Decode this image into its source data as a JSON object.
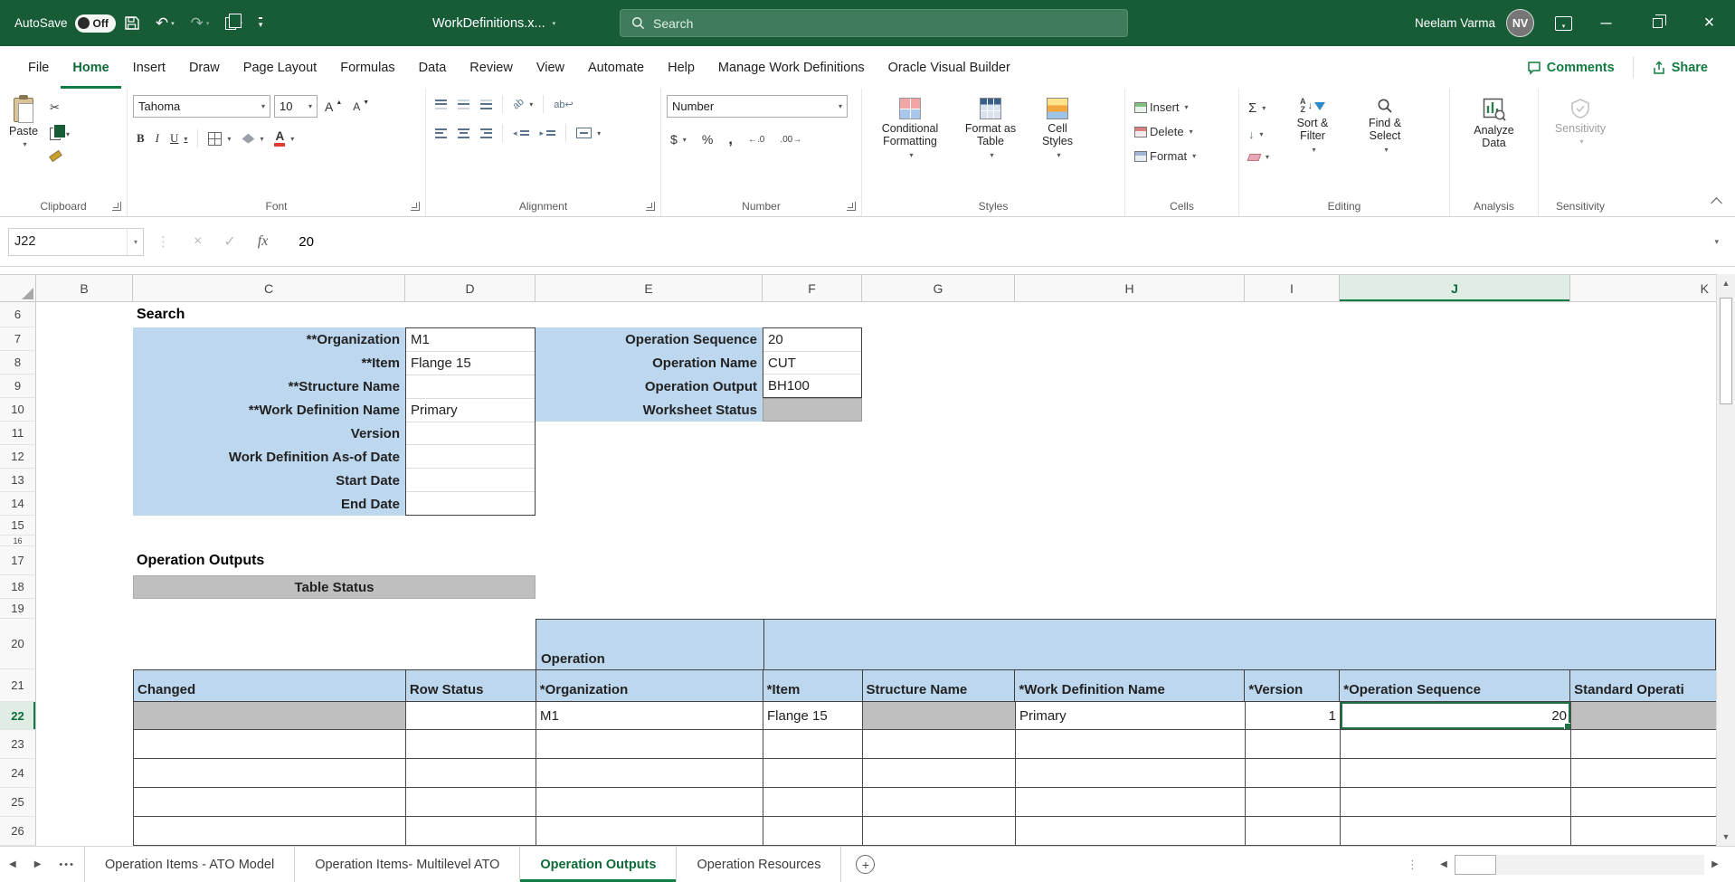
{
  "colors": {
    "titlebar_green": "#185C37",
    "accent_green": "#107C41",
    "cell_blue": "#BDD7EE",
    "cell_gray": "#BFBFBF"
  },
  "titlebar": {
    "autosave_label": "AutoSave",
    "autosave_state": "Off",
    "document_title": "WorkDefinitions.x...",
    "search_placeholder": "Search",
    "user_name": "Neelam Varma",
    "user_initials": "NV"
  },
  "menu": {
    "tabs": [
      "File",
      "Home",
      "Insert",
      "Draw",
      "Page Layout",
      "Formulas",
      "Data",
      "Review",
      "View",
      "Automate",
      "Help",
      "Manage Work Definitions",
      "Oracle Visual Builder"
    ],
    "active_tab": "Home",
    "comments": "Comments",
    "share": "Share"
  },
  "ribbon": {
    "paste": "Paste",
    "clipboard_group": "Clipboard",
    "font_name": "Tahoma",
    "font_size": "10",
    "bold_label": "B",
    "italic_label": "I",
    "underline_label": "U",
    "increase_font_label": "A",
    "decrease_font_label": "A",
    "font_color_label": "A",
    "font_group": "Font",
    "orientation_label": "ab",
    "wrap_label": "ab",
    "alignment_group": "Alignment",
    "number_format": "Number",
    "currency_label": "$",
    "percent_label": "%",
    "comma_label": ",",
    "number_group": "Number",
    "conditional_formatting": "Conditional Formatting",
    "format_as_table": "Format as Table",
    "cell_styles": "Cell Styles",
    "styles_group": "Styles",
    "insert": "Insert",
    "delete": "Delete",
    "format": "Format",
    "cells_group": "Cells",
    "autosum_label": "Σ",
    "sort_filter": "Sort & Filter",
    "find_select": "Find & Select",
    "editing_group": "Editing",
    "analyze_data": "Analyze Data",
    "analysis_group": "Analysis",
    "sensitivity": "Sensitivity",
    "sensitivity_group": "Sensitivity"
  },
  "formula_bar": {
    "name_box": "J22",
    "fx_label": "fx",
    "value": "20"
  },
  "grid": {
    "columns": [
      "B",
      "C",
      "D",
      "E",
      "F",
      "G",
      "H",
      "I",
      "J",
      "K"
    ],
    "rows": [
      "6",
      "7",
      "8",
      "9",
      "10",
      "11",
      "12",
      "13",
      "14",
      "15",
      "16",
      "17",
      "18",
      "19",
      "20",
      "21",
      "22",
      "23",
      "24",
      "25",
      "26"
    ],
    "active_cell": "J22"
  },
  "sheet": {
    "search_title": "Search",
    "left_form": [
      {
        "label": "**Organization",
        "value": "M1"
      },
      {
        "label": "**Item",
        "value": "Flange 15"
      },
      {
        "label": "**Structure Name",
        "value": ""
      },
      {
        "label": "**Work Definition Name",
        "value": "Primary"
      },
      {
        "label": "Version",
        "value": ""
      },
      {
        "label": "Work Definition As-of Date",
        "value": ""
      },
      {
        "label": "Start Date",
        "value": ""
      },
      {
        "label": "End Date",
        "value": ""
      }
    ],
    "right_form": [
      {
        "label": "Operation Sequence",
        "value": "20"
      },
      {
        "label": "Operation Name",
        "value": "CUT"
      },
      {
        "label": "Operation Output",
        "value": "BH100"
      },
      {
        "label": "Worksheet Status",
        "value": ""
      }
    ],
    "outputs_title": "Operation Outputs",
    "table_status": "Table Status",
    "operation_header": "Operation",
    "table_columns": [
      "Changed",
      "Row Status",
      "*Organization",
      "*Item",
      "Structure Name",
      "*Work Definition Name",
      "*Version",
      "*Operation Sequence",
      "Standard Operati"
    ],
    "table_row": [
      "",
      "",
      "M1",
      "Flange 15",
      "",
      "Primary",
      "1",
      "20",
      ""
    ]
  },
  "sheet_tabs": {
    "items": [
      "Operation Items - ATO Model",
      "Operation Items- Multilevel ATO",
      "Operation Outputs",
      "Operation Resources"
    ],
    "active": "Operation Outputs"
  }
}
